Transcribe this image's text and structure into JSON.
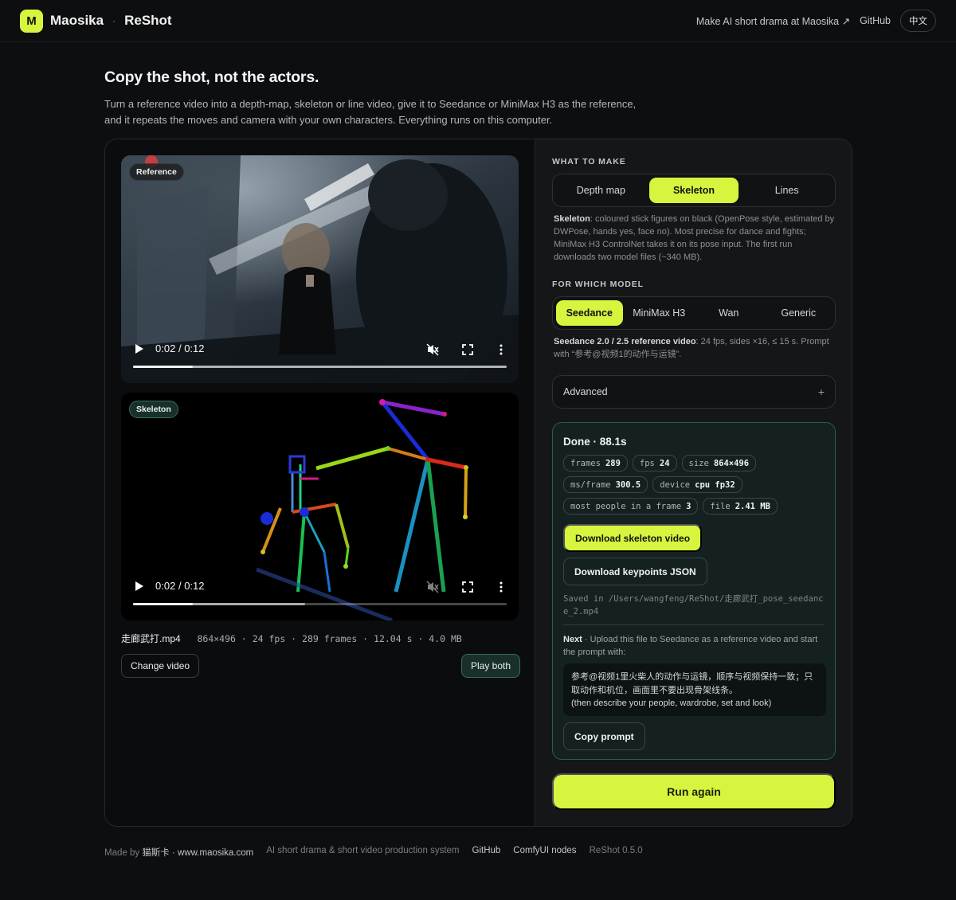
{
  "header": {
    "logo_letter": "M",
    "brand": "Maosika",
    "separator": "·",
    "product": "ReShot",
    "nav": {
      "make_drama": "Make AI short drama at Maosika ↗",
      "github": "GitHub",
      "language": "中文"
    }
  },
  "hero": {
    "title": "Copy the shot, not the actors.",
    "description": "Turn a reference video into a depth-map, skeleton or line video, give it to Seedance or MiniMax H3 as the reference,\nand it repeats the moves and camera with your own characters. Everything runs on this computer."
  },
  "reference_video": {
    "badge": "Reference",
    "time_current": "0:02",
    "time_sep": "/",
    "time_total": "0:12",
    "progress_fraction": 0.16,
    "buffered_fraction": 1.0
  },
  "skeleton_video": {
    "badge": "Skeleton",
    "time_current": "0:02",
    "time_sep": "/",
    "time_total": "0:12",
    "progress_fraction": 0.16,
    "buffered_fraction": 0.46
  },
  "file": {
    "name": "走廊武打.mp4",
    "meta": "864×496 · 24 fps · 289 frames · 12.04 s · 4.0 MB"
  },
  "left_actions": {
    "change_video": "Change video",
    "play_both": "Play both"
  },
  "what_to_make": {
    "label": "WHAT TO MAKE",
    "options": [
      "Depth map",
      "Skeleton",
      "Lines"
    ],
    "selected": "Skeleton",
    "desc_strong": "Skeleton",
    "desc_rest": ": coloured stick figures on black (OpenPose style, estimated by DWPose, hands yes, face no). Most precise for dance and fights; MiniMax H3 ControlNet takes it on its pose input. The first run downloads two model files (~340 MB)."
  },
  "for_which_model": {
    "label": "FOR WHICH MODEL",
    "options": [
      "Seedance",
      "MiniMax H3",
      "Wan",
      "Generic"
    ],
    "selected": "Seedance",
    "desc_strong": "Seedance 2.0 / 2.5 reference video",
    "desc_rest": ": 24 fps, sides ×16, ≤ 15 s. Prompt with “参考@视频1的动作与运镜”."
  },
  "advanced": {
    "label": "Advanced",
    "toggle": "+"
  },
  "result": {
    "title": "Done · 88.1s",
    "stats": [
      {
        "key": "frames",
        "value": "289"
      },
      {
        "key": "fps",
        "value": "24"
      },
      {
        "key": "size",
        "value": "864×496"
      },
      {
        "key": "ms/frame",
        "value": "300.5"
      },
      {
        "key": "device",
        "value": "cpu fp32"
      },
      {
        "key": "most people in a frame",
        "value": "3"
      },
      {
        "key": "file",
        "value": "2.41 MB"
      }
    ],
    "download_video": "Download skeleton video",
    "download_json": "Download keypoints JSON",
    "saved_path": "Saved in /Users/wangfeng/ReShot/走廊武打_pose_seedance_2.mp4",
    "next_strong": "Next",
    "next_rest": " · Upload this file to Seedance as a reference video and start the prompt with:",
    "prompt": "参考@视频1里火柴人的动作与运镜，顺序与视频保持一致；只取动作和机位，画面里不要出现骨架线条。\n(then describe your people, wardrobe, set and look)",
    "copy_prompt": "Copy prompt"
  },
  "run_again": "Run again",
  "footer": {
    "made_by_prefix": "Made by ",
    "made_by_name": "猫斯卡 · www.maosika.com",
    "tagline": "AI short drama & short video production system",
    "github": "GitHub",
    "comfy": "ComfyUI nodes",
    "version": "ReShot 0.5.0"
  },
  "colors": {
    "accent": "#d7f43e",
    "background": "#0d0e0f",
    "panel": "#141617",
    "done_border": "#2e5a52"
  }
}
